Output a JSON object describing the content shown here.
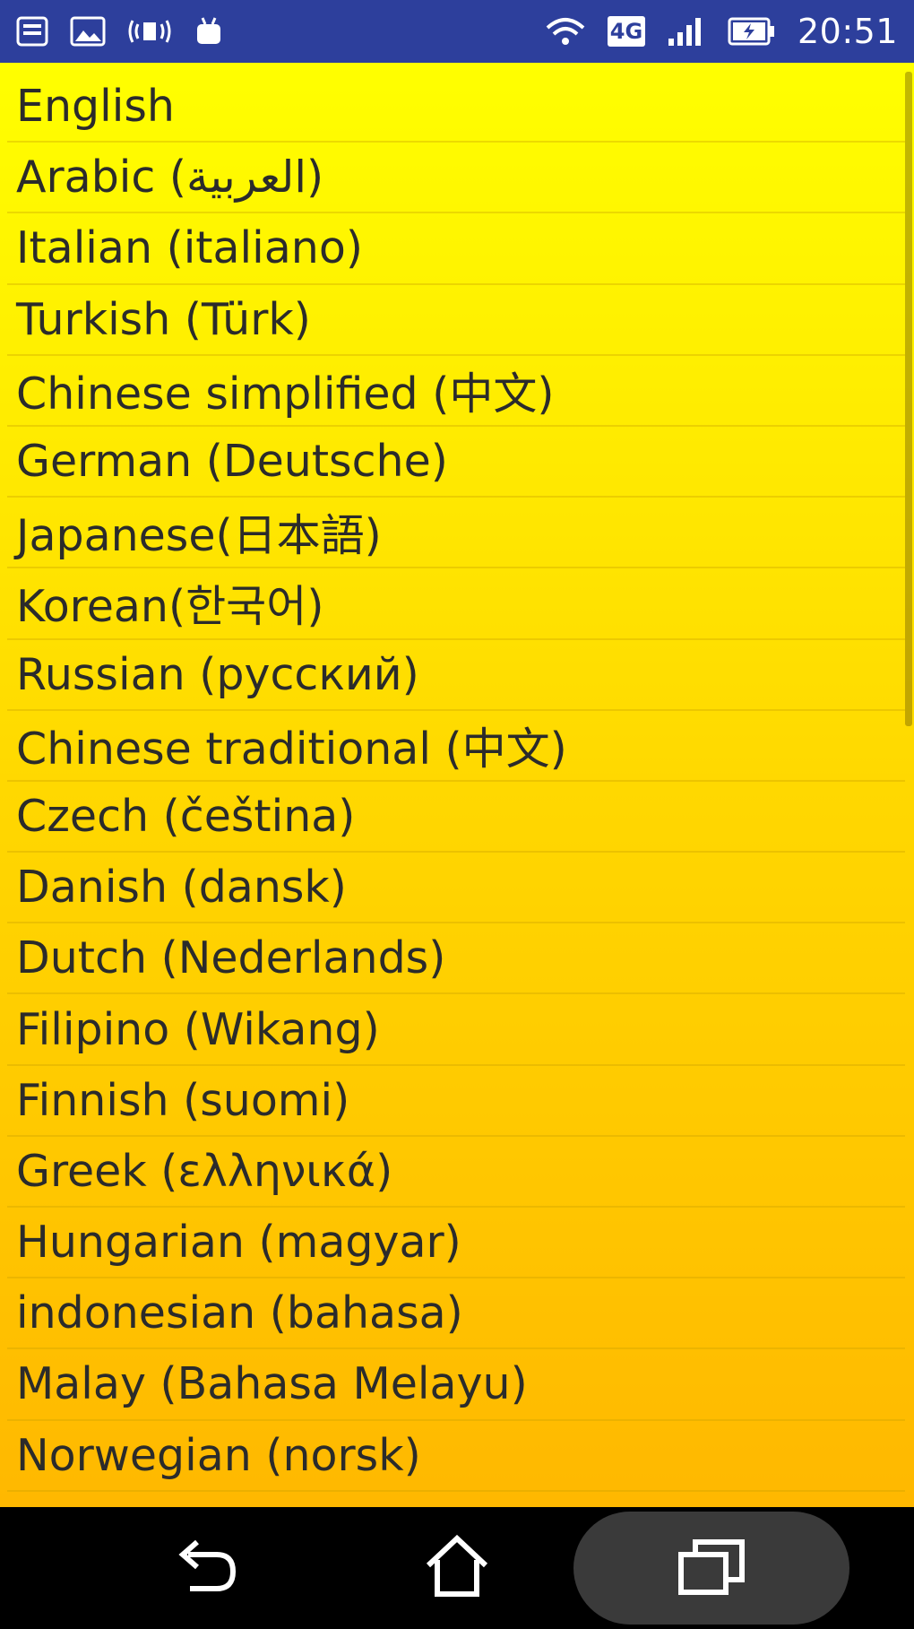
{
  "status_bar": {
    "time": "20:51",
    "network_label": "4G",
    "left_icons": [
      "image-icon",
      "gallery-icon",
      "nfc-icon",
      "android-icon"
    ],
    "right_icons": [
      "wifi-icon",
      "4g-icon",
      "signal-icon",
      "battery-icon"
    ]
  },
  "languages": [
    "English",
    "Arabic (العربية)",
    "Italian (italiano)",
    "Turkish (Türk)",
    "Chinese simplified (中文)",
    "German (Deutsche)",
    "Japanese(日本語)",
    "Korean(한국어)",
    "Russian (русский)",
    "Chinese traditional (中文)",
    "Czech (čeština)",
    "Danish (dansk)",
    "Dutch (Nederlands)",
    "Filipino (Wikang)",
    "Finnish (suomi)",
    "Greek (ελληνικά)",
    "Hungarian (magyar)",
    "indonesian (bahasa)",
    "Malay (Bahasa Melayu)",
    "Norwegian (norsk)"
  ],
  "nav_bar": {
    "buttons": [
      "back-icon",
      "home-icon",
      "recent-apps-icon"
    ]
  },
  "colors": {
    "status_bar": "#2d3f9c",
    "list_top": "#ffff00",
    "list_bottom": "#ffb800",
    "text": "#2b2b2b",
    "nav_bar": "#000000"
  }
}
